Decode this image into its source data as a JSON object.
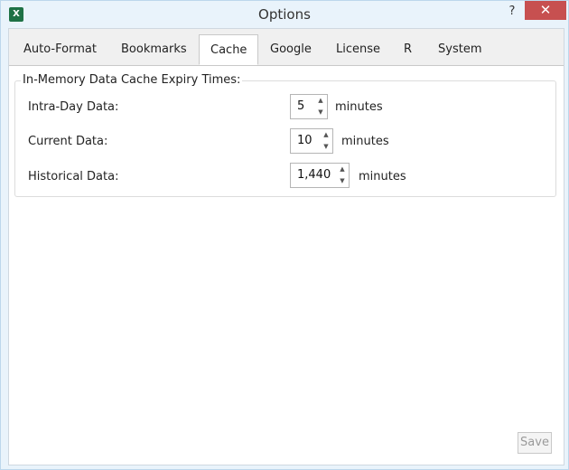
{
  "window": {
    "title": "Options",
    "app_icon_text": "X",
    "help_label": "?",
    "close_label": "✕"
  },
  "tabs": [
    {
      "label": "Auto-Format",
      "active": false
    },
    {
      "label": "Bookmarks",
      "active": false
    },
    {
      "label": "Cache",
      "active": true
    },
    {
      "label": "Google",
      "active": false
    },
    {
      "label": "License",
      "active": false
    },
    {
      "label": "R",
      "active": false
    },
    {
      "label": "System",
      "active": false
    }
  ],
  "cache": {
    "group_title": "In-Memory Data Cache Expiry Times:",
    "rows": [
      {
        "label": "Intra-Day Data:",
        "value": "5",
        "unit": "minutes"
      },
      {
        "label": "Current Data:",
        "value": "10",
        "unit": "minutes"
      },
      {
        "label": "Historical Data:",
        "value": "1,440",
        "unit": "minutes"
      }
    ]
  },
  "spin_icons": {
    "up": "▲",
    "down": "▼"
  },
  "footer": {
    "save_label": "Save",
    "save_enabled": false
  },
  "colors": {
    "close_button": "#c75050",
    "title_bar": "#e9f3fb",
    "excel_icon": "#1e7145"
  }
}
